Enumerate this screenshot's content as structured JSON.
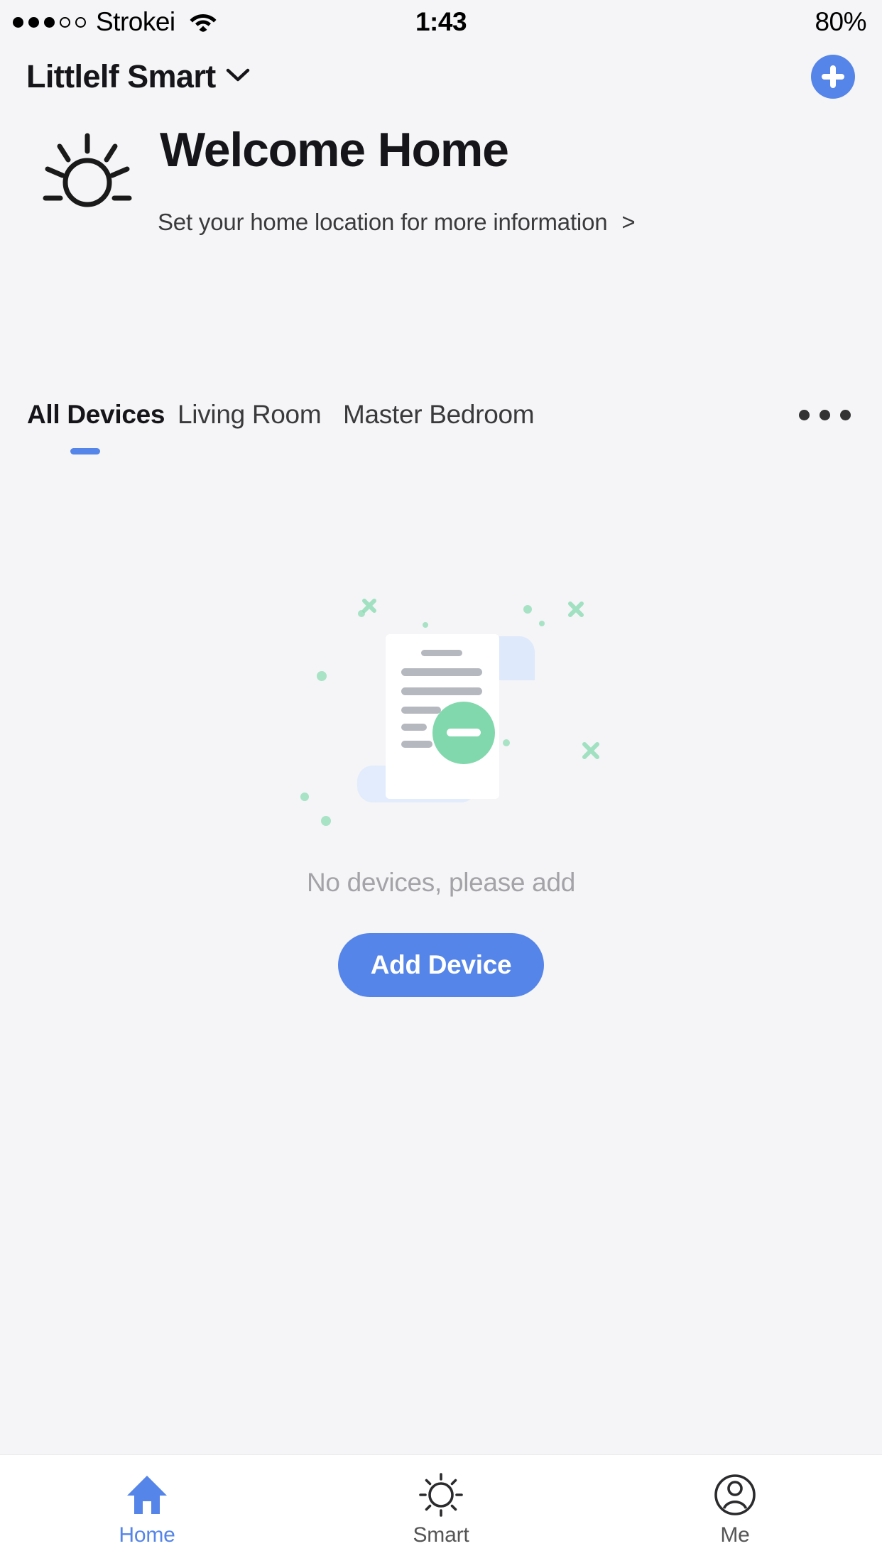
{
  "status_bar": {
    "signal_dots_filled": 3,
    "signal_dots_total": 5,
    "carrier": "Strokei",
    "wifi_icon": "wifi-icon",
    "time": "1:43",
    "battery": "80%"
  },
  "header": {
    "title": "Littlelf Smart",
    "dropdown_icon": "chevron-down-icon",
    "add_icon": "plus-icon"
  },
  "welcome": {
    "sun_icon": "sun-icon",
    "title": "Welcome Home",
    "subtitle": "Set your home location for more information",
    "arrow": ">"
  },
  "tabs": {
    "items": [
      {
        "label": "All Devices",
        "active": true
      },
      {
        "label": "Living Room",
        "active": false
      },
      {
        "label": "Master Bedroom",
        "active": false
      }
    ],
    "more_icon": "ellipsis-icon"
  },
  "empty_state": {
    "illustration": "empty-document-icon",
    "message": "No devices, please add",
    "button_label": "Add Device"
  },
  "bottom_nav": {
    "items": [
      {
        "label": "Home",
        "icon": "home-icon",
        "active": true
      },
      {
        "label": "Smart",
        "icon": "sun-icon",
        "active": false
      },
      {
        "label": "Me",
        "icon": "person-icon",
        "active": false
      }
    ]
  },
  "colors": {
    "accent": "#5585e8",
    "page_bg": "#f5f5f7",
    "nav_bg": "#ffffff",
    "text_primary": "#16161a",
    "text_muted": "#a3a3a8",
    "illustration_green": "#7fd6ab",
    "illustration_blue": "#dde8fb"
  }
}
